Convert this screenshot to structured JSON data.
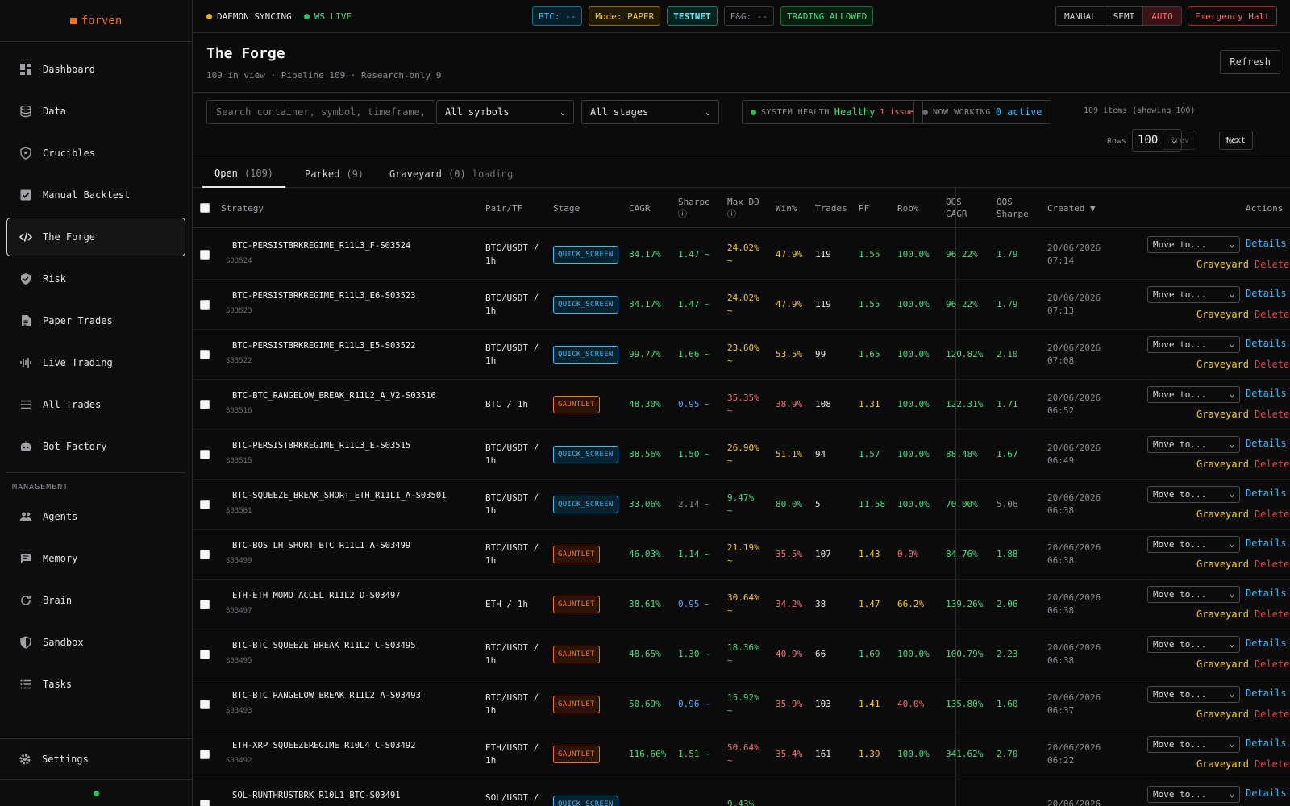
{
  "brand": {
    "name": "forven"
  },
  "sidebar": {
    "items": [
      {
        "label": "Dashboard",
        "icon": "dashboard-icon"
      },
      {
        "label": "Data",
        "icon": "database-icon"
      },
      {
        "label": "Crucibles",
        "icon": "shield-icon"
      },
      {
        "label": "Manual Backtest",
        "icon": "checkbox-icon"
      },
      {
        "label": "The Forge",
        "icon": "code-icon",
        "active": true
      },
      {
        "label": "Risk",
        "icon": "shield-check-icon"
      },
      {
        "label": "Paper Trades",
        "icon": "document-icon"
      },
      {
        "label": "Live Trading",
        "icon": "signal-icon"
      },
      {
        "label": "All Trades",
        "icon": "list-icon"
      },
      {
        "label": "Bot Factory",
        "icon": "robot-icon"
      }
    ],
    "management_label": "MANAGEMENT",
    "management_items": [
      {
        "label": "Agents",
        "icon": "people-icon"
      },
      {
        "label": "Memory",
        "icon": "message-icon"
      },
      {
        "label": "Brain",
        "icon": "refresh-icon"
      },
      {
        "label": "Sandbox",
        "icon": "shield-half-icon"
      },
      {
        "label": "Tasks",
        "icon": "checklist-icon"
      }
    ],
    "settings_label": "Settings"
  },
  "topbar": {
    "daemon": "DAEMON SYNCING",
    "ws": "WS LIVE",
    "chips": {
      "btc": "BTC: --",
      "mode": "Mode: PAPER",
      "net": "TESTNET",
      "fg": "F&G: --",
      "trading": "TRADING ALLOWED"
    },
    "modes": [
      "MANUAL",
      "SEMI",
      "AUTO"
    ],
    "active_mode": "AUTO",
    "halt": "Emergency Halt",
    "colors": {
      "syncing": "#eab308",
      "live": "#22c55e",
      "accent": "#f97316"
    }
  },
  "page": {
    "title": "The Forge",
    "subtitle": "109 in view · Pipeline 109 · Research-only 9",
    "refresh": "Refresh"
  },
  "filters": {
    "search_placeholder": "Search container, symbol, timeframe, id...",
    "symbols": "All symbols",
    "stages": "All stages",
    "health_label": "SYSTEM HEALTH",
    "health_value": "Healthy",
    "health_issue": "1 issue",
    "working_label": "NOW WORKING",
    "working_value": "0 active",
    "count": "109 items (showing 100)",
    "rows_label": "Rows",
    "rows_value": "100",
    "prev": "Prev",
    "page_info": "1/2",
    "next": "Next"
  },
  "tabs": [
    {
      "label": "Open",
      "count": "(109)"
    },
    {
      "label": "Parked",
      "count": "(9)"
    },
    {
      "label": "Graveyard",
      "count": "(0)",
      "extra": "loading"
    }
  ],
  "table": {
    "headers": {
      "strategy": "Strategy",
      "pair": "Pair/TF",
      "stage": "Stage",
      "cagr": "CAGR",
      "sharpe": "Sharpe",
      "maxdd": "Max DD",
      "win": "Win%",
      "trades": "Trades",
      "pf": "PF",
      "rob": "Rob%",
      "oos_cagr_1": "OOS",
      "oos_cagr_2": "CAGR",
      "oos_sharpe_1": "OOS",
      "oos_sharpe_2": "Sharpe",
      "created": "Created ▼",
      "actions": "Actions"
    },
    "move_label": "Move to...",
    "details_label": "Details",
    "graveyard_label": "Graveyard",
    "delete_label": "Delete",
    "rows": [
      {
        "name": "BTC-PERSISTBRKREGIME_R11L3_F-S03524",
        "id": "S03524",
        "pair1": "BTC/USDT /",
        "pair2": "1h",
        "stage": "QUICK_SCREEN",
        "cagr": "84.17%",
        "sharpe": "1.47 ~",
        "dd1": "24.02%",
        "dd2": "~",
        "win": "47.9%",
        "trades": "119",
        "pf": "1.55",
        "rob": "100.0%",
        "oos_cagr": "96.22%",
        "oos_sharpe": "1.79",
        "date": "20/06/2026",
        "time": "07:14",
        "cls": {
          "sharpe": "c-green",
          "dd": "c-yellow",
          "win": "c-yellow",
          "pf": "c-green",
          "rob": "c-green"
        }
      },
      {
        "name": "BTC-PERSISTBRKREGIME_R11L3_E6-S03523",
        "id": "S03523",
        "pair1": "BTC/USDT /",
        "pair2": "1h",
        "stage": "QUICK_SCREEN",
        "cagr": "84.17%",
        "sharpe": "1.47 ~",
        "dd1": "24.02%",
        "dd2": "~",
        "win": "47.9%",
        "trades": "119",
        "pf": "1.55",
        "rob": "100.0%",
        "oos_cagr": "96.22%",
        "oos_sharpe": "1.79",
        "date": "20/06/2026",
        "time": "07:13",
        "cls": {
          "sharpe": "c-green",
          "dd": "c-yellow",
          "win": "c-yellow",
          "pf": "c-green",
          "rob": "c-green"
        }
      },
      {
        "name": "BTC-PERSISTBRKREGIME_R11L3_E5-S03522",
        "id": "S03522",
        "pair1": "BTC/USDT /",
        "pair2": "1h",
        "stage": "QUICK_SCREEN",
        "cagr": "99.77%",
        "sharpe": "1.66 ~",
        "dd1": "23.60%",
        "dd2": "~",
        "win": "53.5%",
        "trades": "99",
        "pf": "1.65",
        "rob": "100.0%",
        "oos_cagr": "120.82%",
        "oos_sharpe": "2.10",
        "date": "20/06/2026",
        "time": "07:08",
        "cls": {
          "sharpe": "c-green",
          "dd": "c-yellow",
          "win": "c-yellow",
          "pf": "c-green",
          "rob": "c-green"
        }
      },
      {
        "name": "BTC-BTC_RANGELOW_BREAK_R11L2_A_V2-S03516",
        "id": "S03516",
        "pair1": "BTC / 1h",
        "pair2": "",
        "stage": "GAUNTLET",
        "cagr": "48.30%",
        "sharpe": "0.95 ~",
        "dd1": "35.35%",
        "dd2": "~",
        "win": "38.9%",
        "trades": "108",
        "pf": "1.31",
        "rob": "100.0%",
        "oos_cagr": "122.31%",
        "oos_sharpe": "1.71",
        "date": "20/06/2026",
        "time": "06:52",
        "cls": {
          "sharpe": "c-blue",
          "dd": "c-red",
          "win": "c-red",
          "pf": "c-yellow",
          "rob": "c-green"
        }
      },
      {
        "name": "BTC-PERSISTBRKREGIME_R11L3_E-S03515",
        "id": "S03515",
        "pair1": "BTC/USDT /",
        "pair2": "1h",
        "stage": "QUICK_SCREEN",
        "cagr": "88.56%",
        "sharpe": "1.50 ~",
        "dd1": "26.90%",
        "dd2": "~",
        "win": "51.1%",
        "trades": "94",
        "pf": "1.57",
        "rob": "100.0%",
        "oos_cagr": "88.48%",
        "oos_sharpe": "1.67",
        "date": "20/06/2026",
        "time": "06:49",
        "cls": {
          "sharpe": "c-green",
          "dd": "c-yellow",
          "win": "c-yellow",
          "pf": "c-green",
          "rob": "c-green"
        }
      },
      {
        "name": "BTC-SQUEEZE_BREAK_SHORT_ETH_R11L1_A-S03501",
        "id": "S03501",
        "pair1": "BTC/USDT /",
        "pair2": "1h",
        "stage": "QUICK_SCREEN",
        "cagr": "33.06%",
        "sharpe": "2.14 ~",
        "dd1": "9.47%",
        "dd2": "~",
        "win": "80.0%",
        "trades": "5",
        "pf": "11.58",
        "rob": "100.0%",
        "oos_cagr": "70.00%",
        "oos_sharpe": "5.06",
        "date": "20/06/2026",
        "time": "06:38",
        "cls": {
          "sharpe": "c-grey",
          "dd": "c-green",
          "win": "c-green",
          "pf": "c-green",
          "rob": "c-green",
          "oos_sharpe": "c-grey"
        }
      },
      {
        "name": "BTC-BOS_LH_SHORT_BTC_R11L1_A-S03499",
        "id": "S03499",
        "pair1": "BTC/USDT /",
        "pair2": "1h",
        "stage": "GAUNTLET",
        "cagr": "46.03%",
        "sharpe": "1.14 ~",
        "dd1": "21.19%",
        "dd2": "~",
        "win": "35.5%",
        "trades": "107",
        "pf": "1.43",
        "rob": "0.0%",
        "oos_cagr": "84.76%",
        "oos_sharpe": "1.88",
        "date": "20/06/2026",
        "time": "06:38",
        "cls": {
          "sharpe": "c-green",
          "dd": "c-yellow",
          "win": "c-red",
          "pf": "c-yellow",
          "rob": "c-red"
        }
      },
      {
        "name": "ETH-ETH_MOMO_ACCEL_R11L2_D-S03497",
        "id": "S03497",
        "pair1": "ETH / 1h",
        "pair2": "",
        "stage": "GAUNTLET",
        "cagr": "38.61%",
        "sharpe": "0.95 ~",
        "dd1": "30.64%",
        "dd2": "~",
        "win": "34.2%",
        "trades": "38",
        "pf": "1.47",
        "rob": "66.2%",
        "oos_cagr": "139.26%",
        "oos_sharpe": "2.06",
        "date": "20/06/2026",
        "time": "06:38",
        "cls": {
          "sharpe": "c-blue",
          "dd": "c-yellow",
          "win": "c-red",
          "pf": "c-yellow",
          "rob": "c-yellow"
        }
      },
      {
        "name": "BTC-BTC_SQUEEZE_BREAK_R11L2_C-S03495",
        "id": "S03495",
        "pair1": "BTC/USDT /",
        "pair2": "1h",
        "stage": "GAUNTLET",
        "cagr": "48.65%",
        "sharpe": "1.30 ~",
        "dd1": "18.36%",
        "dd2": "~",
        "win": "40.9%",
        "trades": "66",
        "pf": "1.69",
        "rob": "100.0%",
        "oos_cagr": "100.79%",
        "oos_sharpe": "2.23",
        "date": "20/06/2026",
        "time": "06:38",
        "cls": {
          "sharpe": "c-green",
          "dd": "c-green",
          "win": "c-red",
          "pf": "c-green",
          "rob": "c-green"
        }
      },
      {
        "name": "BTC-BTC_RANGELOW_BREAK_R11L2_A-S03493",
        "id": "S03493",
        "pair1": "BTC/USDT /",
        "pair2": "1h",
        "stage": "GAUNTLET",
        "cagr": "50.69%",
        "sharpe": "0.96 ~",
        "dd1": "15.92%",
        "dd2": "~",
        "win": "35.9%",
        "trades": "103",
        "pf": "1.41",
        "rob": "40.0%",
        "oos_cagr": "135.80%",
        "oos_sharpe": "1.60",
        "date": "20/06/2026",
        "time": "06:37",
        "cls": {
          "sharpe": "c-blue",
          "dd": "c-green",
          "win": "c-red",
          "pf": "c-yellow",
          "rob": "c-red"
        }
      },
      {
        "name": "ETH-XRP_SQUEEZEREGIME_R10L4_C-S03492",
        "id": "S03492",
        "pair1": "ETH/USDT /",
        "pair2": "1h",
        "stage": "GAUNTLET",
        "cagr": "116.66%",
        "sharpe": "1.51 ~",
        "dd1": "50.64%",
        "dd2": "~",
        "win": "35.4%",
        "trades": "161",
        "pf": "1.39",
        "rob": "100.0%",
        "oos_cagr": "341.62%",
        "oos_sharpe": "2.70",
        "date": "20/06/2026",
        "time": "06:22",
        "cls": {
          "sharpe": "c-green",
          "dd": "c-red",
          "win": "c-red",
          "pf": "c-yellow",
          "rob": "c-green"
        }
      },
      {
        "name": "SOL-RUNTHRUSTBRK_R10L1_BTC-S03491",
        "id": "S03491",
        "pair1": "SOL/USDT /",
        "pair2": "1h",
        "stage": "QUICK_SCREEN",
        "cagr": "",
        "sharpe": "",
        "dd1": "9.43%",
        "dd2": "",
        "win": "",
        "trades": "",
        "pf": "",
        "rob": "",
        "oos_cagr": "",
        "oos_sharpe": "",
        "date": "20/06/2026",
        "time": "",
        "cls": {
          "sharpe": "c-green",
          "dd": "c-green",
          "win": "c-green",
          "pf": "c-green",
          "rob": "c-green"
        }
      }
    ]
  }
}
